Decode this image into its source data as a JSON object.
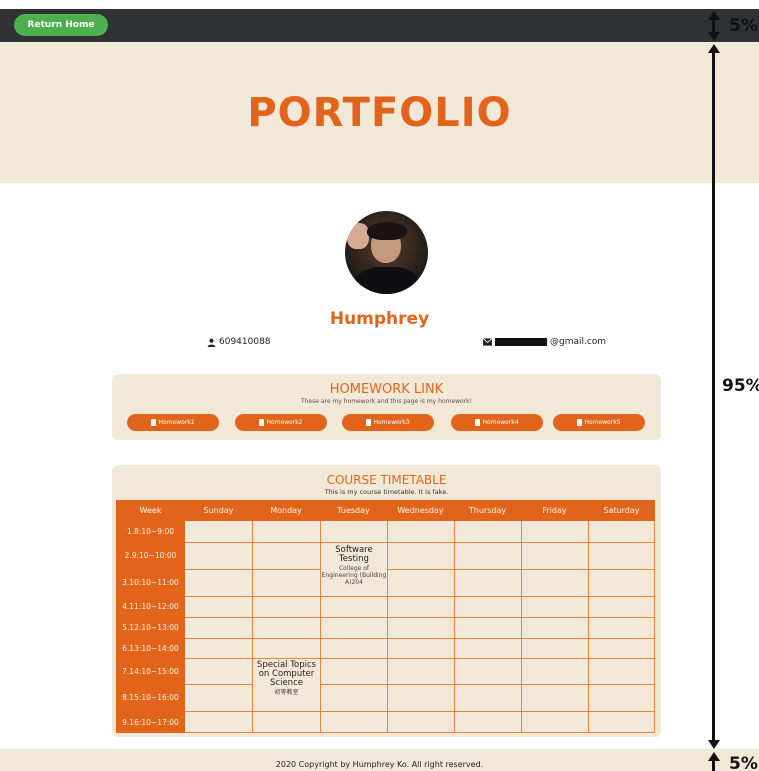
{
  "topbar": {
    "home_label": "Return Home"
  },
  "hero": {
    "title": "PORTFOLIO"
  },
  "profile": {
    "name": "Humphrey",
    "student_id": "609410088",
    "email_suffix": "@gmail.com"
  },
  "homework": {
    "title": "HOMEWORK LINK",
    "subtitle": "These are my homework and this page is my homework!",
    "buttons": [
      "Homework1",
      "Homework2",
      "Homework3",
      "Homework4",
      "Homework5"
    ]
  },
  "timetable": {
    "title": "COURSE TIMETABLE",
    "subtitle": "This is my course timetable. It is fake.",
    "header": [
      "Week",
      "Sunday",
      "Monday",
      "Tuesday",
      "Wednesday",
      "Thursday",
      "Friday",
      "Saturday"
    ],
    "periods": [
      "1.8:10~9:00",
      "2.9:10~10:00",
      "3.10:10~11:00",
      "4.11:10~12:00",
      "5.12:10~13:00",
      "6.13:10~14:00",
      "7.14:10~15:00",
      "8.15:10~16:00",
      "9.16:10~17:00"
    ],
    "courses": [
      {
        "title": "Software Testing",
        "location": "College of Engineering (Building A)204"
      },
      {
        "title": "Special Topics on Computer Science",
        "location": "初等教室"
      }
    ]
  },
  "footer": {
    "text": "2020 Copyright by Humphrey Ko. All right reserved."
  },
  "annotations": {
    "top": "5%",
    "middle": "95%",
    "bottom": "5%"
  }
}
